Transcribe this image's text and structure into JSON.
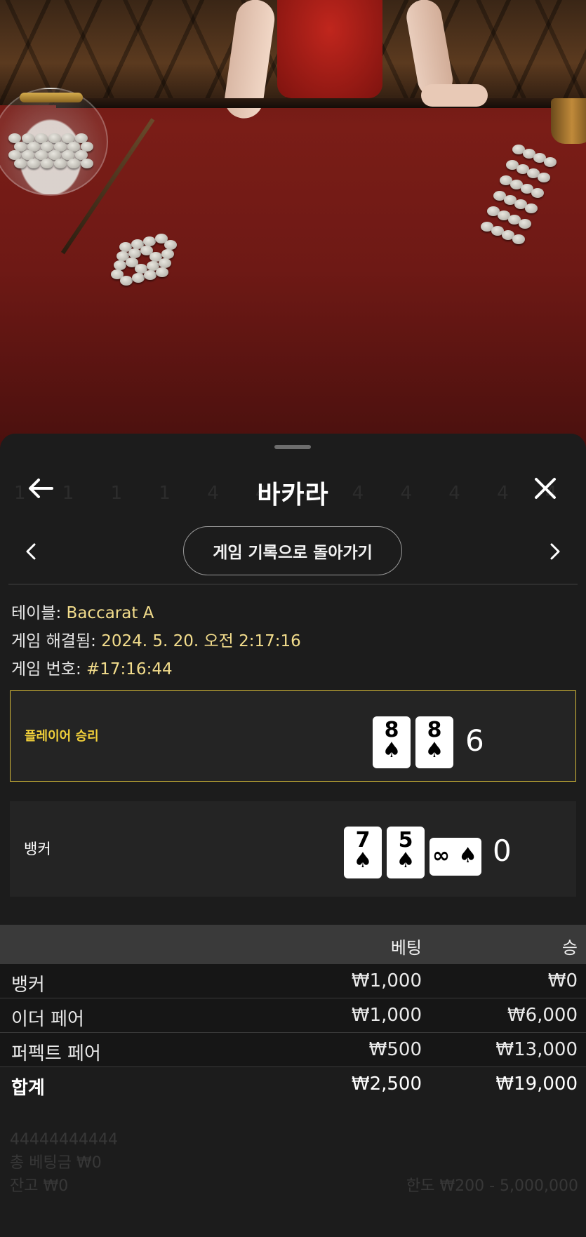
{
  "app": {
    "title": "바카라",
    "back_label": "게임 기록으로 돌아가기"
  },
  "info": {
    "table_label": "테이블:",
    "table_value": "Baccarat A",
    "resolved_label": "게임 해결됨:",
    "resolved_value": "2024. 5. 20. 오전 2:17:16",
    "game_no_label": "게임 번호:",
    "game_no_value": "#17:16:44"
  },
  "results": {
    "player": {
      "label": "플레이어 승리",
      "cards": [
        {
          "rank": "8",
          "suit": "♠"
        },
        {
          "rank": "8",
          "suit": "♠"
        }
      ],
      "score": "6"
    },
    "banker": {
      "label": "뱅커",
      "cards": [
        {
          "rank": "7",
          "suit": "♠"
        },
        {
          "rank": "5",
          "suit": "♠"
        },
        {
          "rank": "∞",
          "suit": "♠",
          "sideways": true
        }
      ],
      "score": "0"
    }
  },
  "bets": {
    "headers": {
      "bet": "베팅",
      "win": "승"
    },
    "rows": [
      {
        "name": "뱅커",
        "bet": "₩1,000",
        "win": "₩0"
      },
      {
        "name": "이더 페어",
        "bet": "₩1,000",
        "win": "₩6,000"
      },
      {
        "name": "퍼펙트 페어",
        "bet": "₩500",
        "win": "₩13,000"
      }
    ],
    "total": {
      "name": "합계",
      "bet": "₩2,500",
      "win": "₩19,000"
    }
  },
  "footer_ghost": {
    "line1": "44444444444",
    "line2": "총 베팅금 ₩0",
    "line3": "잔고 ₩0",
    "limit": "한도 ₩200 - 5,000,000"
  },
  "colors": {
    "accent": "#f0cf3a",
    "win_border": "#d6bb39",
    "value_text": "#f3dd8c",
    "sheet_bg": "#1c1c1c"
  },
  "icons": {
    "back": "arrow-left-icon",
    "close": "close-icon",
    "prev": "chevron-left-icon",
    "next": "chevron-right-icon"
  }
}
